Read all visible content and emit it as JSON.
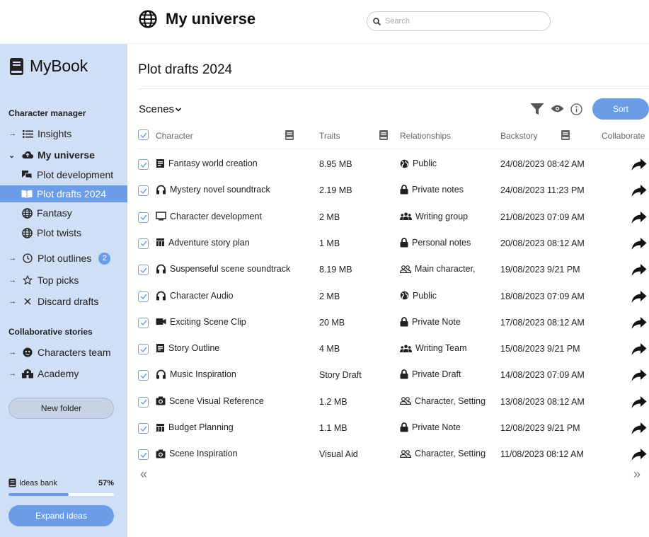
{
  "app": {
    "name": "MyBook"
  },
  "header": {
    "title": "My universe",
    "search_placeholder": "Search"
  },
  "sidebar": {
    "section1_title": "Character manager",
    "items": [
      {
        "label": "Insights",
        "icon": "list-icon"
      },
      {
        "label": "My universe",
        "icon": "cloud-icon"
      },
      {
        "label": "Plot development",
        "icon": "chat-icon"
      },
      {
        "label": "Plot drafts 2024",
        "icon": "book-open-icon"
      },
      {
        "label": "Fantasy",
        "icon": "globe-icon"
      },
      {
        "label": "Plot twists",
        "icon": "globe-icon"
      },
      {
        "label": "Plot outlines",
        "icon": "clock-icon",
        "badge": "2"
      },
      {
        "label": "Top picks",
        "icon": "star-icon"
      },
      {
        "label": "Discard drafts",
        "icon": "close-icon"
      }
    ],
    "section2_title": "Collaborative stories",
    "collab": [
      {
        "label": "Characters team",
        "icon": "face-icon"
      },
      {
        "label": "Academy",
        "icon": "school-icon"
      }
    ],
    "new_folder": "New folder",
    "ideas_label": "Ideas bank",
    "ideas_percent": "57%",
    "ideas_progress": 0.57,
    "expand_label": "Expand ideas"
  },
  "main": {
    "page_title": "Plot drafts 2024",
    "view_label": "Scenes",
    "sort_label": "Sort",
    "columns": {
      "character": "Character",
      "traits": "Traits",
      "relationships": "Relationships",
      "backstory": "Backstory",
      "collaborate": "Collaborate"
    },
    "rows": [
      {
        "name": "Fantasy world creation",
        "icon": "doc-icon",
        "traits": "8.95 MB",
        "rel": "Public",
        "rel_icon": "globe-icon",
        "back": "24/08/2023 08:42 AM"
      },
      {
        "name": "Mystery novel soundtrack",
        "icon": "headphones-icon",
        "traits": "2.19 MB",
        "rel": "Private notes",
        "rel_icon": "lock-icon",
        "back": "24/08/2023 11:23 PM"
      },
      {
        "name": "Character development",
        "icon": "monitor-icon",
        "traits": "2 MB",
        "rel": "Writing group",
        "rel_icon": "group-icon",
        "back": "21/08/2023 07:09 AM"
      },
      {
        "name": "Adventure story plan",
        "icon": "table-icon",
        "traits": "1 MB",
        "rel": "Personal notes",
        "rel_icon": "lock-icon",
        "back": "20/08/2023 08:12 AM"
      },
      {
        "name": "Suspenseful scene soundtrack",
        "icon": "headphones-icon",
        "traits": "8.19 MB",
        "rel": "Main character,",
        "rel_icon": "people-icon",
        "back": "19/08/2023 9/21 PM"
      },
      {
        "name": "Character Audio",
        "icon": "headphones-icon",
        "traits": "2 MB",
        "rel": "Public",
        "rel_icon": "globe-icon",
        "back": "18/08/2023 07:09 AM"
      },
      {
        "name": "Exciting Scene Clip",
        "icon": "video-icon",
        "traits": "20 MB",
        "rel": "Private Note",
        "rel_icon": "lock-icon",
        "back": "17/08/2023 08:12 AM"
      },
      {
        "name": "Story Outline",
        "icon": "doc-icon",
        "traits": "4 MB",
        "rel": "Writing Team",
        "rel_icon": "group-icon",
        "back": "15/08/2023 9/21 PM"
      },
      {
        "name": "Music Inspiration",
        "icon": "headphones-icon",
        "traits": "Story Draft",
        "rel": "Private Draft",
        "rel_icon": "lock-icon",
        "back": "14/08/2023 07:09 AM"
      },
      {
        "name": "Scene Visual Reference",
        "icon": "camera-icon",
        "traits": "1.2 MB",
        "rel": "Character, Setting",
        "rel_icon": "people-icon",
        "back": "13/08/2023 08:12 AM"
      },
      {
        "name": "Budget Planning",
        "icon": "table-icon",
        "traits": "1.1 MB",
        "rel": "Private Note",
        "rel_icon": "lock-icon",
        "back": "12/08/2023 9/21 PM"
      },
      {
        "name": "Scene Inspiration",
        "icon": "camera-icon",
        "traits": "Visual Aid",
        "rel": "Character, Setting",
        "rel_icon": "people-icon",
        "back": "11/08/2023 08:12 AM"
      }
    ],
    "pager_prev": "«",
    "pager_next": "»"
  },
  "colors": {
    "accent": "#6b9de6",
    "sidebar_bg": "#cfdff5"
  }
}
